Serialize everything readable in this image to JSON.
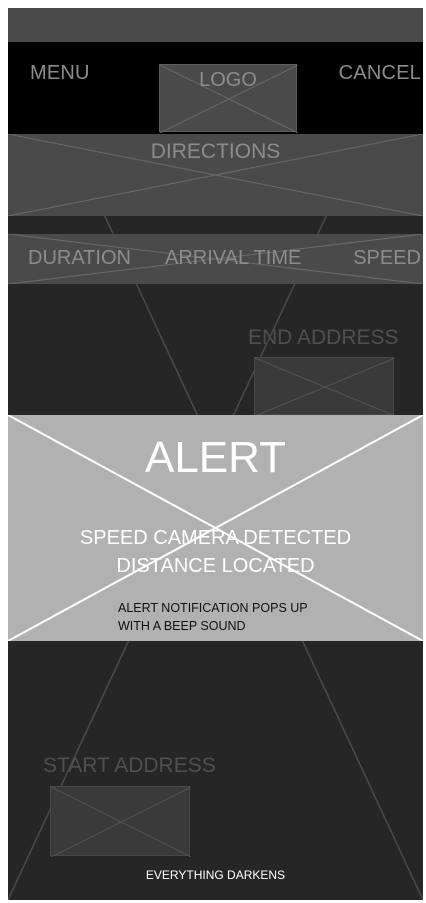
{
  "navbar": {
    "menu_label": "MENU",
    "logo_label": "LOGO",
    "cancel_label": "CANCEL"
  },
  "directions": {
    "label": "DIRECTIONS"
  },
  "trip_info": {
    "duration_label": "DURATION",
    "arrival_label": "ARRIVAL TIME",
    "speed_label": "SPEED"
  },
  "end_address": {
    "label": "END ADDRESS"
  },
  "alert": {
    "title": "ALERT",
    "line1": "SPEED CAMERA DETECTED",
    "line2": "DISTANCE LOCATED",
    "note_line1": "ALERT NOTIFICATION POPS UP",
    "note_line2": "WITH A BEEP SOUND"
  },
  "start_address": {
    "label": "START ADDRESS"
  },
  "footer": {
    "note": "EVERYTHING DARKENS"
  },
  "colors": {
    "background": "#262626",
    "panel": "#4a4a4a",
    "navbar": "#000000",
    "alert": "#b1b1b1",
    "text_muted": "#8c8c8c"
  }
}
